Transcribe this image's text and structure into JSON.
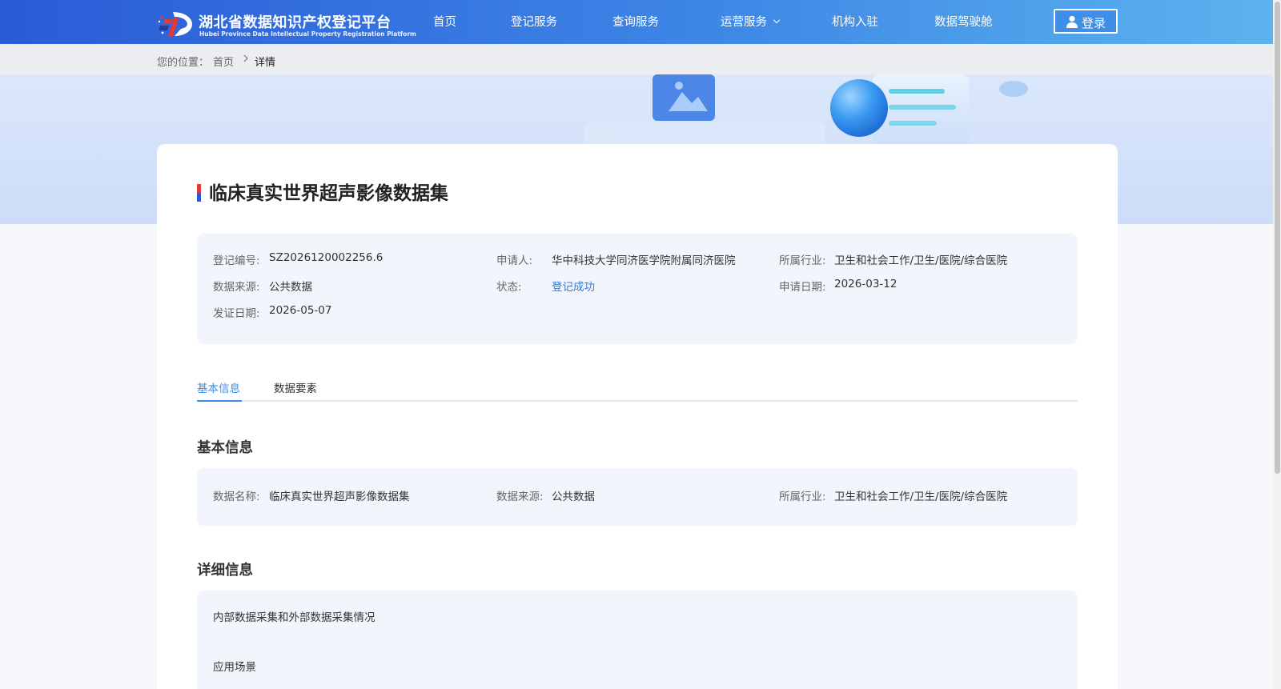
{
  "header": {
    "logo_cn": "湖北省数据知识产权登记平台",
    "logo_en": "Hubei Province Data Intellectual Property Registration Platform",
    "nav": [
      {
        "label": "首页"
      },
      {
        "label": "登记服务"
      },
      {
        "label": "查询服务"
      },
      {
        "label": "运营服务",
        "has_dropdown": true
      },
      {
        "label": "机构入驻"
      },
      {
        "label": "数据驾驶舱"
      }
    ],
    "login_label": "登录"
  },
  "breadcrumb": {
    "prefix": "您的位置：",
    "home": "首页",
    "current": "详情"
  },
  "detail": {
    "title": "临床真实世界超声影像数据集",
    "fields": [
      {
        "label": "登记编号:",
        "value": "SZ2026120002256.6"
      },
      {
        "label": "申请人:",
        "value": "华中科技大学同济医学院附属同济医院"
      },
      {
        "label": "所属行业:",
        "value": "卫生和社会工作/卫生/医院/综合医院"
      },
      {
        "label": "数据来源:",
        "value": "公共数据"
      },
      {
        "label": "状态:",
        "value": "登记成功"
      },
      {
        "label": "申请日期:",
        "value": "2026-03-12"
      },
      {
        "label": "发证日期:",
        "value": "2026-05-07"
      }
    ]
  },
  "tabs": [
    {
      "label": "基本信息",
      "active": true
    },
    {
      "label": "数据要素",
      "active": false
    }
  ],
  "basic_info": {
    "title": "基本信息",
    "fields": [
      {
        "label": "数据名称:",
        "value": "临床真实世界超声影像数据集"
      },
      {
        "label": "数据来源:",
        "value": "公共数据"
      },
      {
        "label": "所属行业:",
        "value": "卫生和社会工作/卫生/医院/综合医院"
      }
    ]
  },
  "detailed_info": {
    "title": "详细信息",
    "items": [
      "内部数据采集和外部数据采集情况",
      "应用场景"
    ]
  },
  "colors": {
    "header_start": "#2a5bd7",
    "header_end": "#5cb4ee",
    "accent": "#3a8ee6",
    "status_success": "#2e7ce0",
    "panel_bg": "#f2f6fc"
  }
}
